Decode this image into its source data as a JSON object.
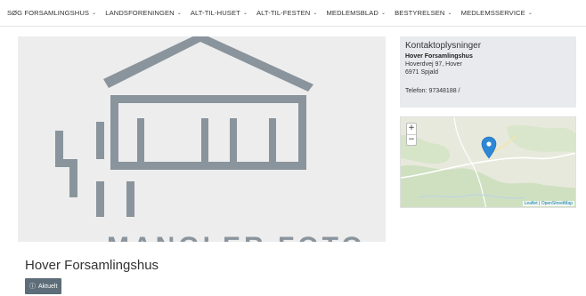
{
  "nav": {
    "items": [
      {
        "label": "SØG FORSAMLINGSHUS"
      },
      {
        "label": "LANDSFORENINGEN"
      },
      {
        "label": "ALT-TIL-HUSET"
      },
      {
        "label": "ALT-TIL-FESTEN"
      },
      {
        "label": "MEDLEMSBLAD"
      },
      {
        "label": "BESTYRELSEN"
      },
      {
        "label": "MEDLEMSSERVICE"
      }
    ],
    "chevron": "⌄"
  },
  "hero": {
    "placeholder_icon": "house-placeholder-icon",
    "placeholder_text": "MANGLER FOTO",
    "shape_color": "#8a949c",
    "background": "#ededed"
  },
  "contact": {
    "title": "Kontaktoplysninger",
    "name": "Hover Forsamlingshus",
    "address": "Hoverdvej 97, Hover",
    "city": "6971 Spjald",
    "phone": "Telefon: 97348188 /"
  },
  "map": {
    "zoom_in": "+",
    "zoom_out": "−",
    "attribution_leaflet": "Leaflet",
    "attribution_sep": " | ",
    "attribution_osm": "OpenStreetMap",
    "marker_color": "#2e86d6"
  },
  "page": {
    "title": "Hover Forsamlingshus",
    "badge_icon": "ⓘ",
    "badge_label": "Aktuelt"
  }
}
